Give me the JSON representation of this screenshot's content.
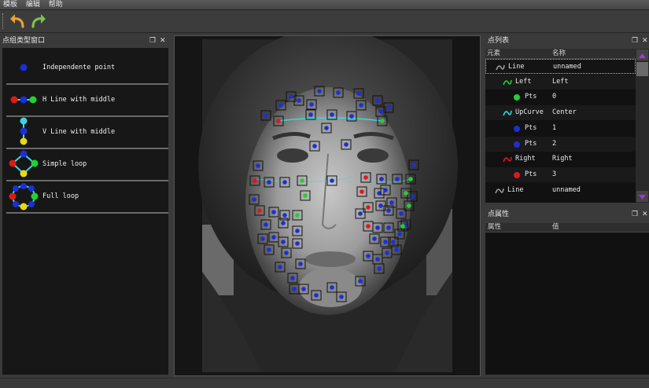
{
  "menu": [
    "模板",
    "编辑",
    "帮助"
  ],
  "toolbar": {
    "undo_icon": "undo-arrow-icon",
    "redo_icon": "redo-arrow-icon",
    "undo_color": "#e8a030",
    "redo_color": "#7cc04a"
  },
  "left_panel": {
    "title": "点组类型窗口",
    "items": [
      {
        "label": "Independente point"
      },
      {
        "label": "H Line with middle"
      },
      {
        "label": "V Line with middle"
      },
      {
        "label": "Simple loop"
      },
      {
        "label": "Full loop"
      }
    ]
  },
  "point_list": {
    "title": "点列表",
    "columns": [
      "元素",
      "名称"
    ],
    "rows": [
      {
        "col1": "Line",
        "col2": "unnamed",
        "icon": "curve-gray-icon",
        "indent": 1
      },
      {
        "col1": "Left",
        "col2": "Left",
        "icon": "curve-green-icon",
        "indent": 2
      },
      {
        "col1": "Pts",
        "col2": "0",
        "icon": "green-point-icon",
        "indent": 3
      },
      {
        "col1": "UpCurve",
        "col2": "Center",
        "icon": "curve-cyan-icon",
        "indent": 2
      },
      {
        "col1": "Pts",
        "col2": "1",
        "icon": "blue-point-icon",
        "indent": 3
      },
      {
        "col1": "Pts",
        "col2": "2",
        "icon": "blue-point-icon",
        "indent": 3
      },
      {
        "col1": "Right",
        "col2": "Right",
        "icon": "curve-red-icon",
        "indent": 2
      },
      {
        "col1": "Pts",
        "col2": "3",
        "icon": "red-point-icon",
        "indent": 3
      },
      {
        "col1": "Line",
        "col2": "unnamed",
        "icon": "curve-gray-icon",
        "indent": 1
      }
    ]
  },
  "properties": {
    "title": "点属性",
    "columns": [
      "属性",
      "值"
    ]
  },
  "colors": {
    "blue": "#1c2fd6",
    "red": "#e01818",
    "green": "#22d030",
    "cyan": "#38d8e0",
    "yellow": "#e8d818",
    "scroll_arrow": "#9a3ad8"
  }
}
